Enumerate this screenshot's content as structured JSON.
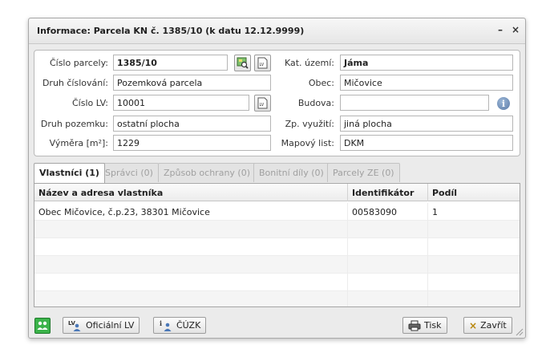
{
  "window": {
    "title": "Informace: Parcela KN č. 1385/10 (k datu 12.12.9999)",
    "minimize": "–",
    "close": "×"
  },
  "form": {
    "cislo_parcely": {
      "label": "Číslo parcely:",
      "value": "1385/10"
    },
    "druh_cislovani": {
      "label": "Druh číslování:",
      "value": "Pozemková parcela"
    },
    "cislo_lv": {
      "label": "Číslo LV:",
      "value": "10001"
    },
    "druh_pozemku": {
      "label": "Druh pozemku:",
      "value": "ostatní plocha"
    },
    "vymera": {
      "label": "Výměra [m²]:",
      "value": "1229"
    },
    "kat_uzemi": {
      "label": "Kat. území:",
      "value": "Jáma"
    },
    "obec": {
      "label": "Obec:",
      "value": "Mičovice"
    },
    "budova": {
      "label": "Budova:",
      "value": ""
    },
    "zp_vyuziti": {
      "label": "Zp. využití:",
      "value": "jiná plocha"
    },
    "mapovy_list": {
      "label": "Mapový list:",
      "value": "DKM"
    }
  },
  "tabs": [
    {
      "label": "Vlastníci (1)",
      "active": true
    },
    {
      "label": "Správci (0)",
      "active": false
    },
    {
      "label": "Způsob ochrany (0)",
      "active": false
    },
    {
      "label": "Bonitní díly (0)",
      "active": false
    },
    {
      "label": "Parcely ZE (0)",
      "active": false
    }
  ],
  "table": {
    "columns": [
      "Název a adresa vlastníka",
      "Identifikátor",
      "Podíl"
    ],
    "rows": [
      [
        "Obec Mičovice, č.p.23, 38301 Mičovice",
        "00583090",
        "1"
      ]
    ]
  },
  "footer": {
    "oficialni_lv": "Oficiální LV",
    "cuzk": "ČÚZK",
    "tisk": "Tisk",
    "zavrit": "Zavřít"
  },
  "colors": {
    "accent_green": "#3bb34a",
    "close_x": "#b8860b",
    "info_blue": "#5a7aa6"
  }
}
